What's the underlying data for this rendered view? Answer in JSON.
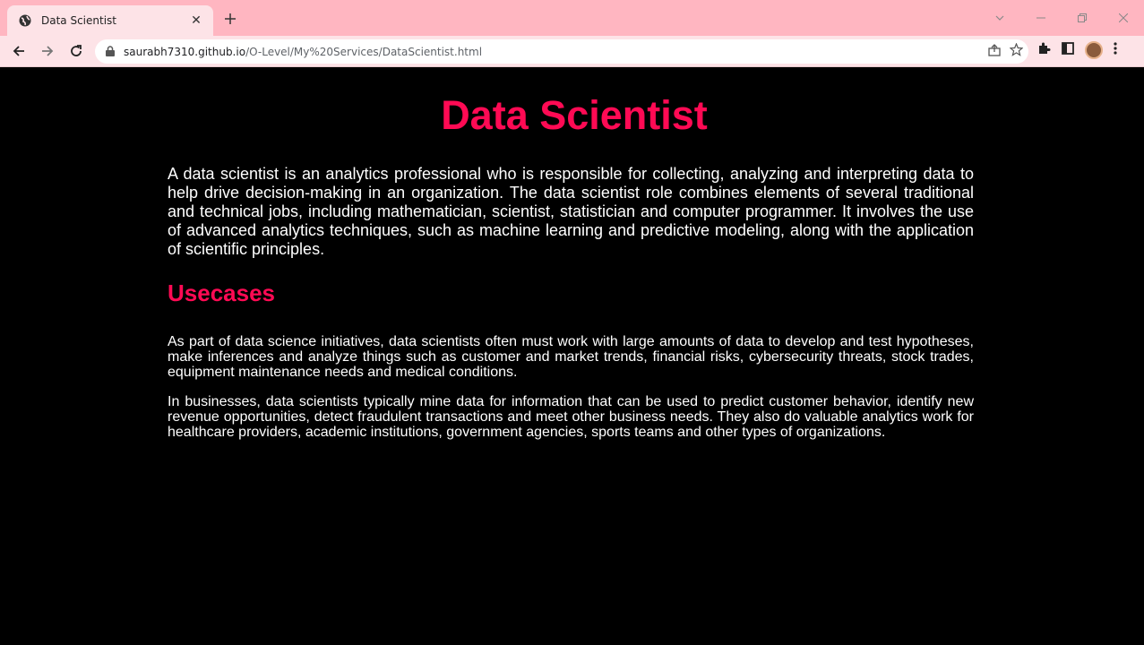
{
  "browser": {
    "tab_title": "Data Scientist",
    "url_host": "saurabh7310.github.io",
    "url_path": "/O-Level/My%20Services/DataScientist.html"
  },
  "page": {
    "title": "Data Scientist",
    "intro": "A data scientist is an analytics professional who is responsible for collecting, analyzing and interpreting data to help drive decision-making in an organization. The data scientist role combines elements of several traditional and technical jobs, including mathematician, scientist, statistician and computer programmer. It involves the use of advanced analytics techniques, such as machine learning and predictive modeling, along with the application of scientific principles.",
    "usecases_heading": "Usecases",
    "usecase_paragraphs": [
      "As part of data science initiatives, data scientists often must work with large amounts of data to develop and test hypotheses, make inferences and analyze things such as customer and market trends, financial risks, cybersecurity threats, stock trades, equipment maintenance needs and medical conditions.",
      "In businesses, data scientists typically mine data for information that can be used to predict customer behavior, identify new revenue opportunities, detect fraudulent transactions and meet other business needs. They also do valuable analytics work for healthcare providers, academic institutions, government agencies, sports teams and other types of organizations."
    ]
  },
  "colors": {
    "accent": "#ff0a54",
    "chrome": "#ffb6c1",
    "background": "#000000",
    "text": "#ffffff"
  }
}
